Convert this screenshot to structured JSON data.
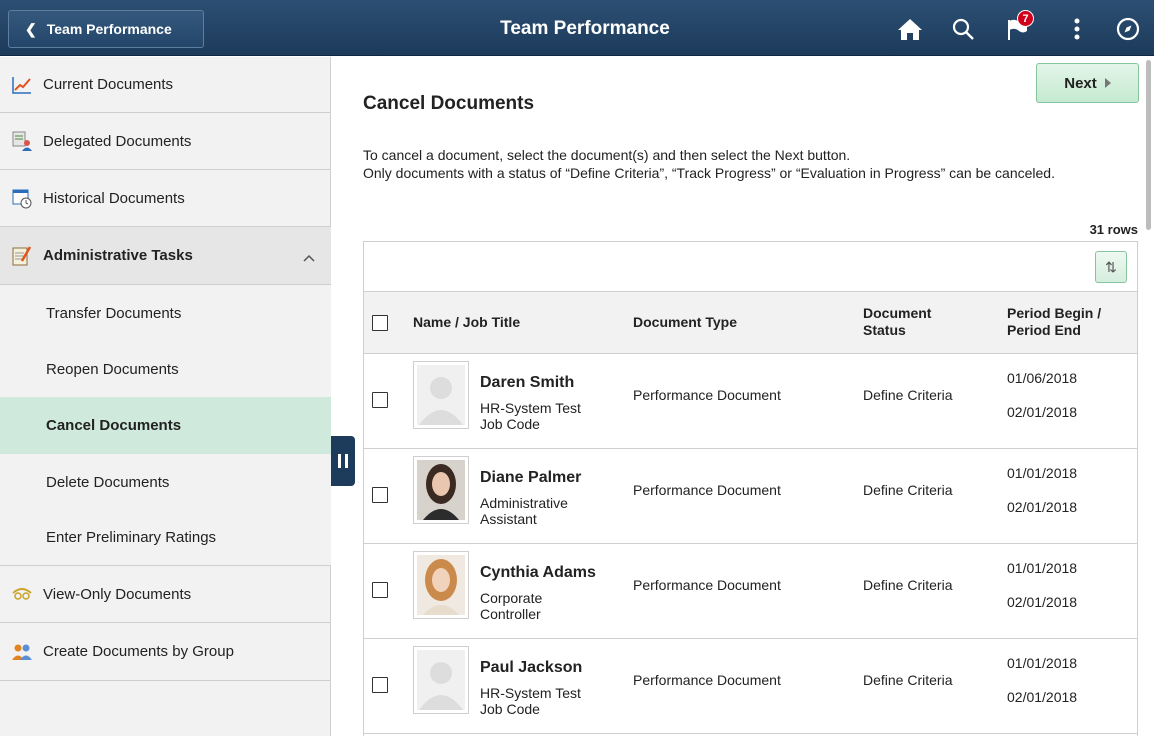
{
  "header": {
    "back_label": "Team Performance",
    "title": "Team Performance",
    "notification_count": "7",
    "icons": [
      "home-icon",
      "search-icon",
      "flag-icon",
      "more-icon",
      "navbar-compass-icon"
    ]
  },
  "sidebar": {
    "items": [
      {
        "label": "Current Documents",
        "icon": "chart-line-icon"
      },
      {
        "label": "Delegated Documents",
        "icon": "delegated-icon"
      },
      {
        "label": "Historical Documents",
        "icon": "calendar-clock-icon"
      },
      {
        "label": "Administrative Tasks",
        "icon": "notepad-pencil-icon"
      }
    ],
    "sub_items": [
      {
        "label": "Transfer Documents"
      },
      {
        "label": "Reopen Documents"
      },
      {
        "label": "Cancel  Documents"
      },
      {
        "label": "Delete Documents"
      },
      {
        "label": "Enter Preliminary Ratings"
      }
    ],
    "bottom_items": [
      {
        "label": "View-Only Documents",
        "icon": "eye-glasses-icon"
      },
      {
        "label": "Create Documents by Group",
        "icon": "group-icon"
      }
    ]
  },
  "main": {
    "next_label": "Next",
    "title": "Cancel Documents",
    "instructions_line1": "To cancel a document, select the document(s) and then select the Next button.",
    "instructions_line2": "Only documents with a status of “Define Criteria”, “Track Progress” or “Evaluation in Progress” can be canceled.",
    "rows_count": "31 rows"
  },
  "table": {
    "headers": {
      "name": "Name / Job Title",
      "type": "Document Type",
      "status_line1": "Document",
      "status_line2": "Status",
      "period_line1": "Period Begin /",
      "period_line2": "Period End"
    },
    "rows": [
      {
        "name": "Daren Smith",
        "job_title": "HR-System Test Job Code",
        "doc_type": "Performance Document",
        "status": "Define Criteria",
        "period_begin": "01/06/2018",
        "period_end": "02/01/2018",
        "photo": "placeholder"
      },
      {
        "name": "Diane Palmer",
        "job_title": "Administrative Assistant",
        "doc_type": "Performance Document",
        "status": "Define Criteria",
        "period_begin": "01/01/2018",
        "period_end": "02/01/2018",
        "photo": "woman-dark-hair"
      },
      {
        "name": "Cynthia Adams",
        "job_title": "Corporate Controller",
        "doc_type": "Performance Document",
        "status": "Define Criteria",
        "period_begin": "01/01/2018",
        "period_end": "02/01/2018",
        "photo": "woman-red-hair"
      },
      {
        "name": "Paul Jackson",
        "job_title": "HR-System Test Job Code",
        "doc_type": "Performance Document",
        "status": "Define Criteria",
        "period_begin": "01/01/2018",
        "period_end": "02/01/2018",
        "photo": "placeholder"
      }
    ]
  },
  "colors": {
    "header": "#1d3b5b",
    "active_item": "#cfe9dc",
    "next_button": "#c5ead1",
    "badge": "#d0021b"
  }
}
